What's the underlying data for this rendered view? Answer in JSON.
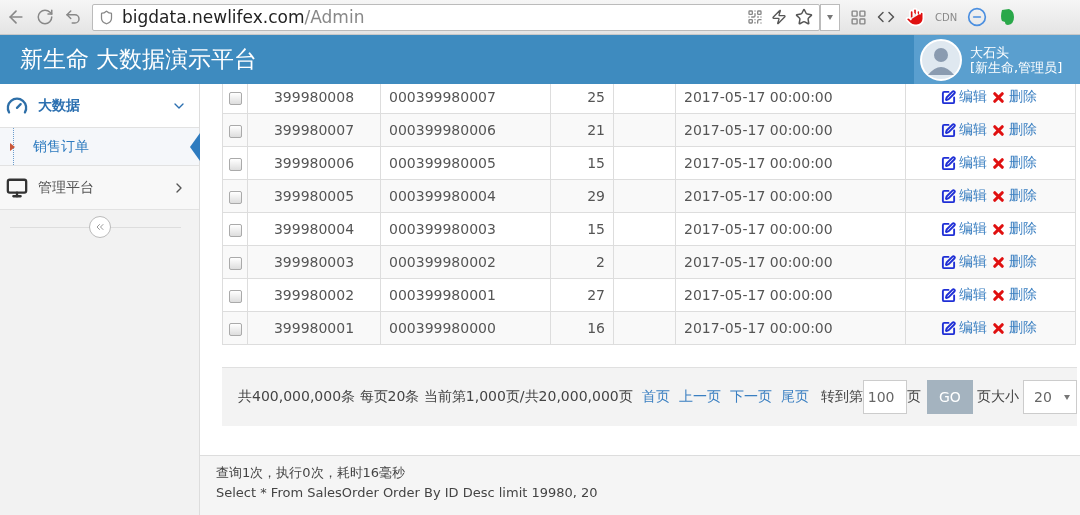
{
  "browser": {
    "url_host": "bigdata.newlifex.com",
    "url_path": "/Admin",
    "cdn_label": "CDN"
  },
  "header": {
    "title": "新生命 大数据演示平台",
    "user_name": "大石头",
    "user_role": "[新生命,管理员]"
  },
  "sidebar": {
    "groups": [
      {
        "label": "大数据",
        "kind": "dashboard",
        "expanded": true,
        "selected": true,
        "children": [
          {
            "label": "销售订单",
            "selected": true
          }
        ]
      },
      {
        "label": "管理平台",
        "kind": "monitor",
        "expanded": false,
        "selected": false
      }
    ]
  },
  "table": {
    "rows": [
      {
        "checked": false,
        "id": "399980008",
        "order_no": "000399980007",
        "amount": "25",
        "date": "2017-05-17 00:00:00",
        "edit": "编辑",
        "delete": "删除"
      },
      {
        "checked": false,
        "id": "399980007",
        "order_no": "000399980006",
        "amount": "21",
        "date": "2017-05-17 00:00:00",
        "edit": "编辑",
        "delete": "删除"
      },
      {
        "checked": false,
        "id": "399980006",
        "order_no": "000399980005",
        "amount": "15",
        "date": "2017-05-17 00:00:00",
        "edit": "编辑",
        "delete": "删除"
      },
      {
        "checked": false,
        "id": "399980005",
        "order_no": "000399980004",
        "amount": "29",
        "date": "2017-05-17 00:00:00",
        "edit": "编辑",
        "delete": "删除"
      },
      {
        "checked": false,
        "id": "399980004",
        "order_no": "000399980003",
        "amount": "15",
        "date": "2017-05-17 00:00:00",
        "edit": "编辑",
        "delete": "删除"
      },
      {
        "checked": false,
        "id": "399980003",
        "order_no": "000399980002",
        "amount": "2",
        "date": "2017-05-17 00:00:00",
        "edit": "编辑",
        "delete": "删除"
      },
      {
        "checked": false,
        "id": "399980002",
        "order_no": "000399980001",
        "amount": "27",
        "date": "2017-05-17 00:00:00",
        "edit": "编辑",
        "delete": "删除"
      },
      {
        "checked": false,
        "id": "399980001",
        "order_no": "000399980000",
        "amount": "16",
        "date": "2017-05-17 00:00:00",
        "edit": "编辑",
        "delete": "删除"
      }
    ]
  },
  "pagination": {
    "summary": "共400,000,000条 每页20条 当前第1,000页/共20,000,000页",
    "links": [
      "首页",
      "上一页",
      "下一页",
      "尾页"
    ],
    "goto_label": "转到第",
    "goto_value": "100",
    "page_suffix": "页",
    "go_button": "GO",
    "size_label": "页大小",
    "size_value": "20"
  },
  "footer": {
    "stats": "查询1次，执行0次，耗时16毫秒",
    "sql": "Select * From SalesOrder Order By ID Desc limit 19980, 20"
  }
}
